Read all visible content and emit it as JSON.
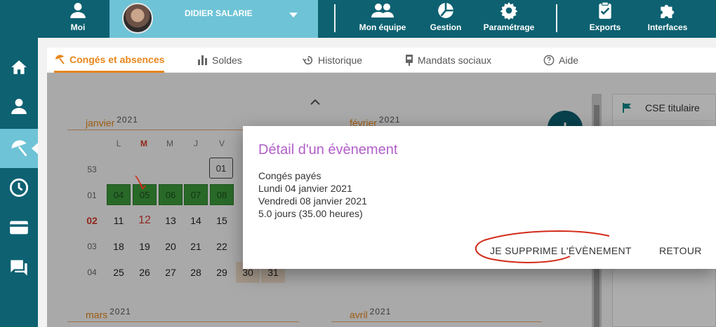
{
  "topbar": {
    "me_label": "Moi",
    "user_name": "DIDIER SALARIE",
    "team_label": "Mon équipe",
    "management_label": "Gestion",
    "settings_label": "Paramétrage",
    "exports_label": "Exports",
    "interfaces_label": "Interfaces"
  },
  "tabs": [
    {
      "label": "Congés et absences",
      "icon": "umbrella-icon"
    },
    {
      "label": "Soldes",
      "icon": "bar-chart-icon"
    },
    {
      "label": "Historique",
      "icon": "history-icon"
    },
    {
      "label": "Mandats sociaux",
      "icon": "badge-icon"
    },
    {
      "label": "Aide",
      "icon": "help-icon"
    }
  ],
  "calendar": {
    "months": [
      {
        "name": "janvier",
        "year": "2021"
      },
      {
        "name": "février",
        "year": "2021"
      },
      {
        "name": "mars",
        "year": "2021"
      },
      {
        "name": "avril",
        "year": "2021"
      }
    ],
    "day_headers": [
      "L",
      "M",
      "M",
      "J",
      "V"
    ],
    "week_numbers": [
      "53",
      "01",
      "02",
      "03",
      "04"
    ],
    "row_53": [
      "01"
    ],
    "row_01": [
      "04",
      "05",
      "06",
      "07",
      "08"
    ],
    "row_02": [
      "11",
      "12",
      "13",
      "14",
      "15"
    ],
    "row_03": [
      "18",
      "19",
      "20",
      "21",
      "22"
    ],
    "row_04": [
      "25",
      "26",
      "27",
      "28",
      "29",
      "30",
      "31"
    ]
  },
  "right_panel": {
    "item": "CSE titulaire"
  },
  "dialog": {
    "title": "Détail d'un évènement",
    "type": "Congés payés",
    "start": "Lundi 04 janvier 2021",
    "end": "Vendredi 08 janvier 2021",
    "duration": "5.0 jours (35.00 heures)",
    "delete_label": "JE SUPPRIME L'ÉVÈNEMENT",
    "back_label": "RETOUR"
  },
  "colors": {
    "teal": "#0d6171",
    "light_teal": "#6ec3d6",
    "orange": "#e8861c",
    "purple": "#b260c9",
    "green": "#3c9b3c"
  }
}
